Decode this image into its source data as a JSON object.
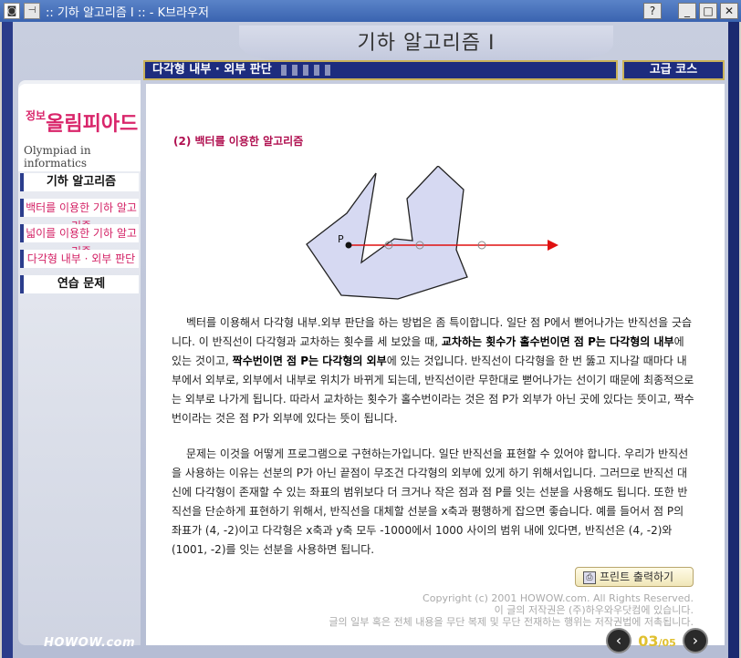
{
  "window": {
    "title": ":: 기하 알고리즘 I :: - K브라우저",
    "help": "?",
    "minimize": "_",
    "maximize": "□",
    "close": "✕"
  },
  "banner": "기하 알고리즘 I",
  "logo": {
    "small": "정보",
    "main": "올림피아드",
    "sub": "Olympiad in informatics"
  },
  "sidebar": {
    "items": [
      {
        "label": "기하 알고리즘"
      },
      {
        "label": "백터를 이용한 기하 알고리즘"
      },
      {
        "label": "넓이를 이용한 기하 알고리즘"
      },
      {
        "label": "다각형 내부 · 외부 판단"
      },
      {
        "label": "연습 문제"
      }
    ]
  },
  "header": {
    "section": "다각형 내부 · 외부 판단",
    "level": "고급 코스"
  },
  "content": {
    "subtitle": "(2) 백터를 이용한 알고리즘",
    "figure_label": "P",
    "p1_a": "벡터를 이용해서 다각형 내부.외부 판단을 하는 방법은 좀 특이합니다. 일단 점 P에서 뻗어나가는 반직선을 긋습니다. 이 반직선이 다각형과 교차하는 횟수를 세 보았을 때, ",
    "p1_b": "교차하는 횟수가 홀수번이면 점 P는 다각형의 내부",
    "p1_c": "에 있는 것이고, ",
    "p1_d": "짝수번이면 점 P는 다각형의 외부",
    "p1_e": "에 있는 것입니다. 반직선이 다각형을 한 번 뚫고 지나갈 때마다 내부에서 외부로, 외부에서 내부로 위치가 바뀌게 되는데, 반직선이란 무한대로 뻗어나가는 선이기 때문에 최종적으로는 외부로 나가게 됩니다. 따라서 교차하는 횟수가 홀수번이라는 것은 점 P가 외부가 아닌 곳에 있다는 뜻이고, 짝수번이라는 것은 점 P가 외부에 있다는 뜻이 됩니다.",
    "p2": "문제는 이것을 어떻게 프로그램으로 구현하는가입니다. 일단 반직선을 표현할 수 있어야 합니다. 우리가 반직선을 사용하는 이유는 선분의 P가 아닌 끝점이 무조건 다각형의 외부에 있게 하기 위해서입니다. 그러므로 반직선 대신에 다각형이 존재할 수 있는 좌표의 범위보다 더 크거나 작은 점과 점 P를 잇는 선분을 사용해도 됩니다. 또한 반직선을 단순하게 표현하기 위해서, 반직선을 대체할 선분을 x축과 평행하게 잡으면 좋습니다. 예를 들어서 점 P의 좌표가 (4, -2)이고 다각형은 x축과 y축 모두 -1000에서 1000 사이의 범위 내에 있다면, 반직선은 (4, -2)와 (1001, -2)를 잇는 선분을 사용하면 됩니다.",
    "print_label": "프린트 출력하기",
    "copyright_1": "Copyright (c) 2001 HOWOW.com. All Rights Reserved.",
    "copyright_2": "이 글의 저작권은 (주)하우와우닷컴에 있습니다.",
    "copyright_3": "글의 일부 혹은 전체 내용을 무단 복제 및 무단 전재하는 행위는 저작권법에 저촉됩니다."
  },
  "footer": {
    "brand": "HOWOW.com",
    "page_current": "03",
    "page_total": "/05"
  }
}
